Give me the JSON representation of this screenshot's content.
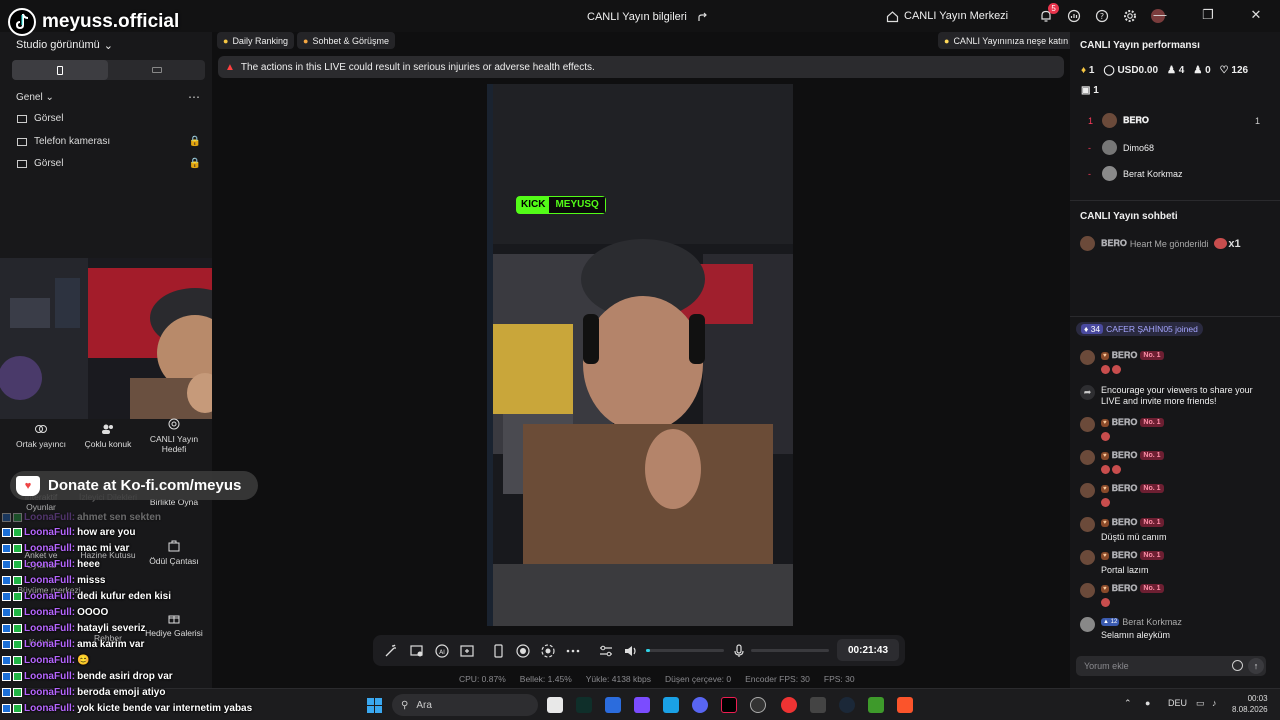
{
  "watermark": {
    "handle": "meyuss.official"
  },
  "titlebar": {
    "title": "CANLI Yayın bilgileri",
    "center_link": "CANLI Yayın Merkezi",
    "notification_count": "5"
  },
  "left": {
    "studio_view": "Studio görünümü",
    "section": "Genel",
    "sources": [
      "Görsel",
      "Telefon kamerası",
      "Görsel"
    ],
    "tools": [
      {
        "label": "Ortak yayıncı"
      },
      {
        "label": "Çoklu konuk"
      },
      {
        "label": "CANLI Yayın Hedefi"
      },
      {
        "label": "İnteraktif Oyunlar"
      },
      {
        "label": "İzleyici Dilekleri"
      },
      {
        "label": "Birlikte Oyna"
      },
      {
        "label": "Anket ve Oylama"
      },
      {
        "label": "Hazine Kutusu"
      },
      {
        "label": "Ödül Çantası"
      },
      {
        "label": "Büyüme merkezi"
      },
      {
        "label": "Kutulu"
      },
      {
        "label": "Rehber"
      },
      {
        "label": "Hediye Galerisi"
      }
    ],
    "kofi": "Donate at Ko-fi.com/meyus"
  },
  "overlay_chat": [
    {
      "user": "LoonaFull:",
      "msg": "ahmet sen sekten"
    },
    {
      "user": "LoonaFull:",
      "msg": "how are you"
    },
    {
      "user": "LoonaFull:",
      "msg": "mac mi var"
    },
    {
      "user": "LoonaFull:",
      "msg": "heee"
    },
    {
      "user": "LoonaFull:",
      "msg": "misss"
    },
    {
      "user": "LoonaFull:",
      "msg": "dedi kufur eden kisi"
    },
    {
      "user": "LoonaFull:",
      "msg": "OOOO"
    },
    {
      "user": "LoonaFull:",
      "msg": "hatayli severiz"
    },
    {
      "user": "LoonaFull:",
      "msg": "ama karim var"
    },
    {
      "user": "LoonaFull:",
      "msg": "😊"
    },
    {
      "user": "LoonaFull:",
      "msg": "bende asiri drop var"
    },
    {
      "user": "LoonaFull:",
      "msg": "beroda emoji atiyo"
    },
    {
      "user": "LoonaFull:",
      "msg": "yok kicte bende var internetim yabas"
    }
  ],
  "main": {
    "chips": [
      "Daily Ranking",
      "Sohbet & Görüşme",
      "CANLI Yayınınıza neşe katın"
    ],
    "warning": "The actions in this LIVE could result in serious injuries or adverse health effects.",
    "kick_badge": [
      "KICK",
      "MEYUSQ"
    ],
    "timer": "00:21:43",
    "volume_fraction": 0.05,
    "stats": [
      "CPU: 0.87%",
      "Bellek: 1.45%",
      "Yükle: 4138 kbps",
      "Düşen çerçeve: 0",
      "Encoder FPS: 30",
      "FPS: 30"
    ]
  },
  "right": {
    "perf_title": "CANLI Yayın performansı",
    "perf": [
      "1",
      "USD0.00",
      "4",
      "0",
      "126"
    ],
    "perf2": "1",
    "ranking": [
      {
        "rank": "1",
        "name": "𝐁𝐄𝐑𝐎",
        "score": "1"
      },
      {
        "rank": "-",
        "name": "Dimo68",
        "score": ""
      },
      {
        "rank": "-",
        "name": "Berat Korkmaz",
        "score": ""
      }
    ],
    "chat_title": "CANLI Yayın sohbeti",
    "gift_name": "𝐁𝐄𝐑𝐎",
    "gift_text": "Heart Me gönderildi",
    "gift_count": "x1",
    "joined_level": "34",
    "joined_text": "CAFER ŞAHİN05 joined",
    "encourage": "Encourage your viewers to share your LIVE and invite more friends!",
    "chat_user": "𝐁𝐄𝐑𝐎",
    "no1": "No. 1",
    "lines": [
      "Düştü mü canım",
      "Portal lazım"
    ],
    "last_level": "12",
    "last_user": "Berat Korkmaz",
    "last_msg": "Selamın aleyküm",
    "input_placeholder": "Yorum ekle"
  },
  "taskbar": {
    "search": "Ara",
    "lang": "DEU",
    "time": "00:03",
    "date": "8.08.2026"
  }
}
